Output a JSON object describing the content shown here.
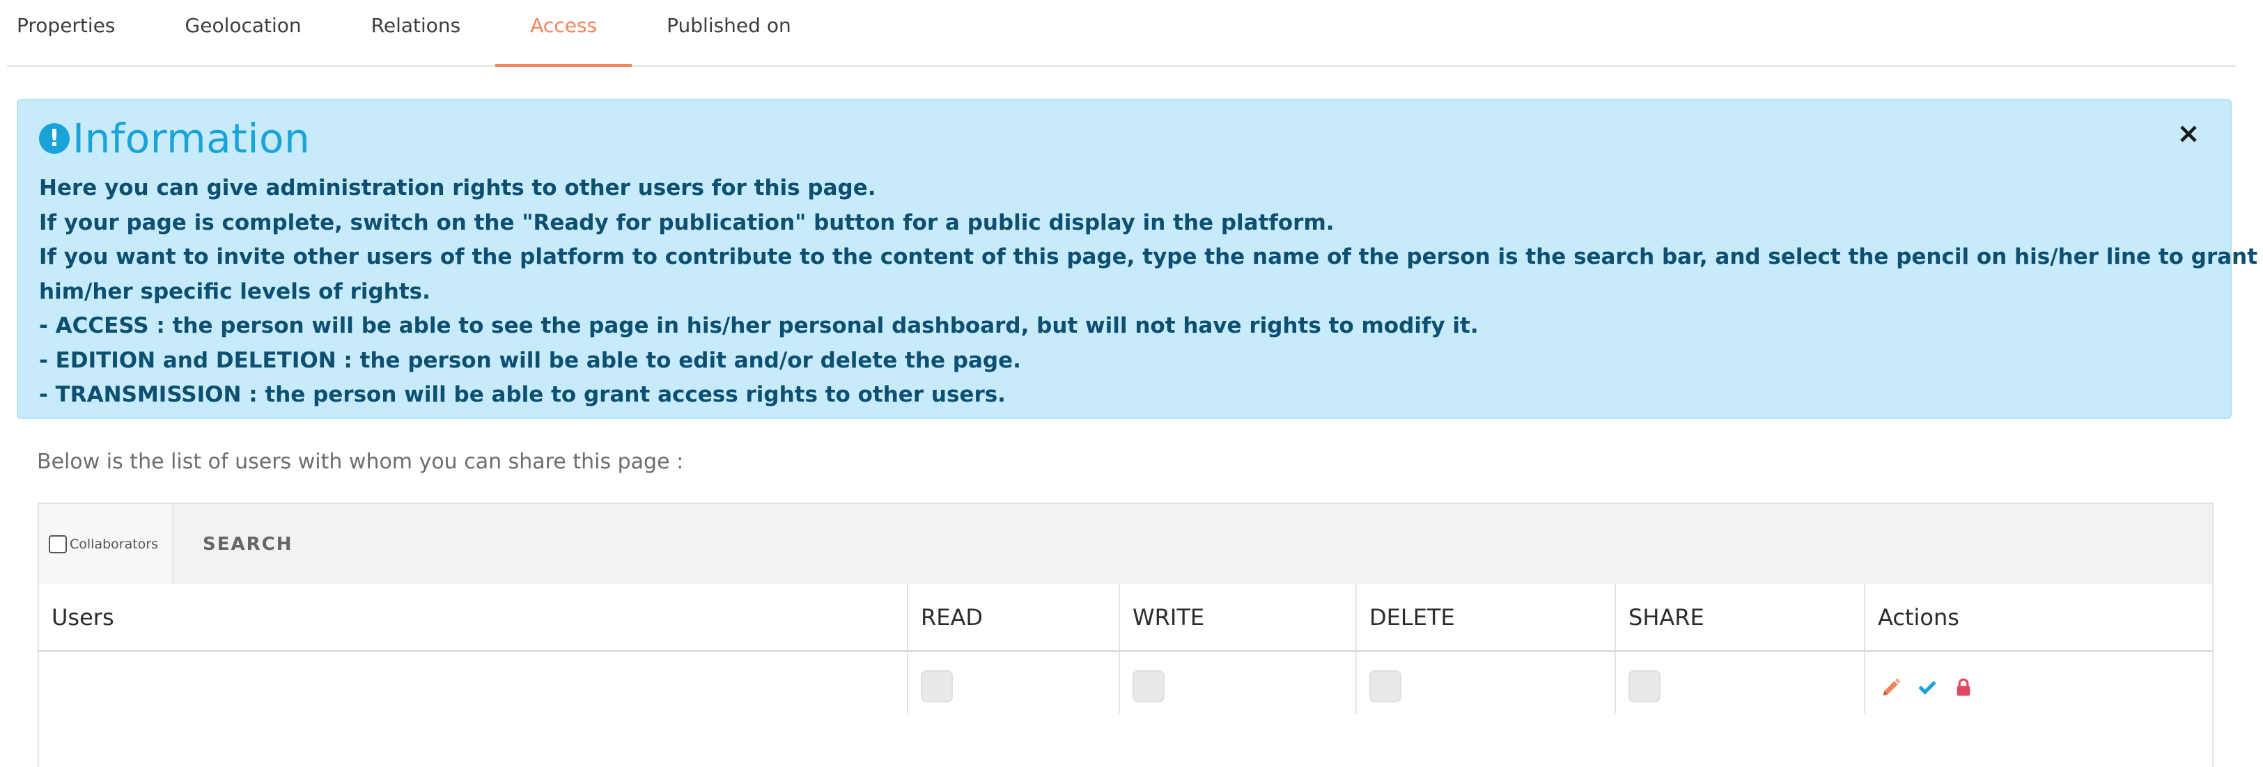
{
  "tabs": [
    {
      "label": "Properties",
      "active": false
    },
    {
      "label": "Geolocation",
      "active": false
    },
    {
      "label": "Relations",
      "active": false
    },
    {
      "label": "Access",
      "active": true
    },
    {
      "label": "Published on",
      "active": false
    }
  ],
  "colors": {
    "accent": "#f0845c",
    "info_bg": "#c7ebfa",
    "info_text": "#0c4f70",
    "info_title": "#1aa3d9",
    "edit_icon": "#f0845c",
    "check_icon": "#1aa3d9",
    "lock_icon": "#e04860"
  },
  "alert": {
    "icon": "exclamation-circle-icon",
    "title": "Information",
    "close_icon": "close-icon",
    "close_label": "×",
    "lines": [
      "Here you can give administration rights to other users for this page.",
      "If your page is complete, switch on the \"Ready for publication\" button for a public display in the platform.",
      "If you want to invite other users of the platform to contribute to the content of this page, type the name of the person is the search bar, and select the pencil on his/her line to grant",
      "him/her specific levels of rights.",
      "- ACCESS : the person will be able to see the page in his/her personal dashboard, but will not have rights to modify it.",
      "- EDITION and DELETION : the person will be able to edit and/or delete the page.",
      "- TRANSMISSION : the person will be able to grant access rights to other users."
    ]
  },
  "intro": "Below is the list of users with whom you can share this page :",
  "toolbar": {
    "collaborators_label": "Collaborators",
    "collaborators_checked": false,
    "search_label": "SEARCH"
  },
  "table": {
    "headers": {
      "users": "Users",
      "read": "READ",
      "write": "WRITE",
      "delete": "DELETE",
      "share": "SHARE",
      "actions": "Actions"
    },
    "rows": [
      {
        "user": "",
        "read": false,
        "write": false,
        "delete": false,
        "share": false,
        "actions": [
          "pencil-icon",
          "check-icon",
          "lock-icon"
        ]
      }
    ]
  }
}
